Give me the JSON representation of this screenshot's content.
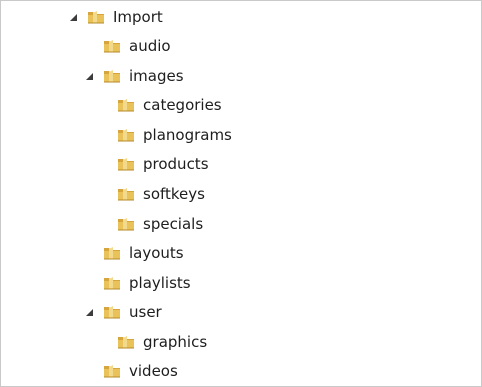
{
  "tree": {
    "root": {
      "label": "Import",
      "children": {
        "audio": {
          "label": "audio"
        },
        "images": {
          "label": "images",
          "children": {
            "categories": {
              "label": "categories"
            },
            "planograms": {
              "label": "planograms"
            },
            "products": {
              "label": "products"
            },
            "softkeys": {
              "label": "softkeys"
            },
            "specials": {
              "label": "specials"
            }
          }
        },
        "layouts": {
          "label": "layouts"
        },
        "playlists": {
          "label": "playlists"
        },
        "user": {
          "label": "user",
          "children": {
            "graphics": {
              "label": "graphics"
            }
          }
        },
        "videos": {
          "label": "videos"
        }
      }
    }
  },
  "icons": {
    "expanded_arrow": "expanded-arrow-icon",
    "folder": "folder-icon"
  },
  "colors": {
    "folder_yellow": "#e9c25a",
    "folder_tan": "#d6a53b",
    "arrow_dark": "#3c3c3c"
  }
}
